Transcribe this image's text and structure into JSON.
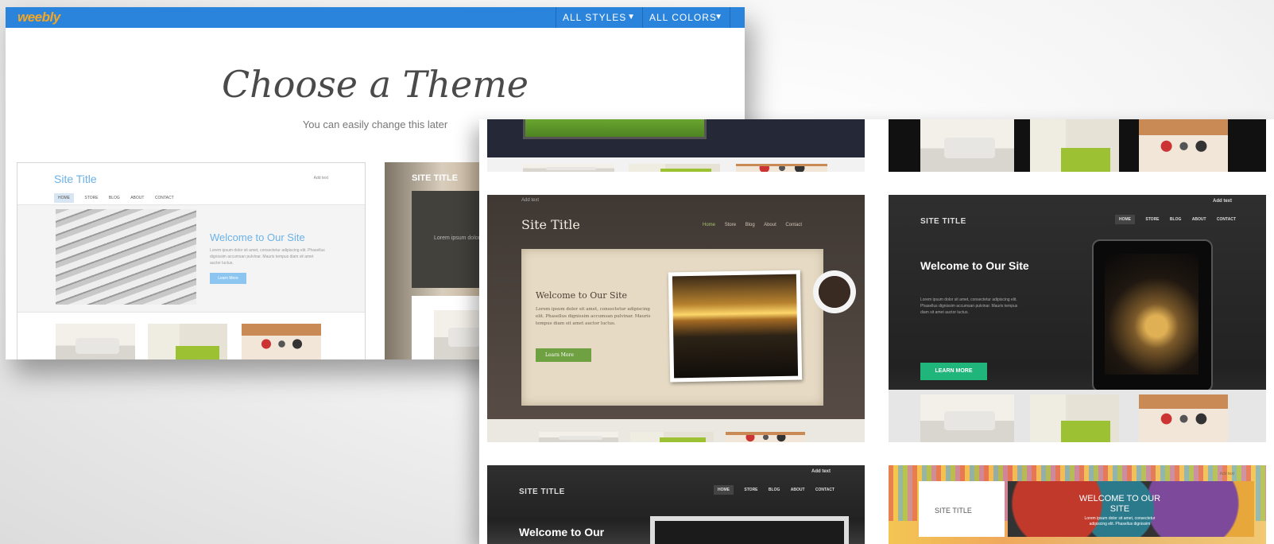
{
  "app": {
    "logo": "weebly",
    "brand_color": "#2b84db",
    "logo_color": "#f5a623"
  },
  "topbar": {
    "styles_label": "ALL STYLES",
    "colors_label": "ALL COLORS"
  },
  "heading": {
    "title": "Choose a Theme",
    "subtitle": "You can easily change this later"
  },
  "theme_light": {
    "site_title": "Site Title",
    "add_text": "Add text",
    "nav": [
      "HOME",
      "STORE",
      "BLOG",
      "ABOUT",
      "CONTACT"
    ],
    "welcome": "Welcome to Our Site",
    "lorem": "Lorem ipsum dolor sit amet, consectetur adipiscing elit. Phasellus dignissim accumsan pulvinar. Mauris tempus diam sit amet auctor luctus.",
    "button": "Learn More"
  },
  "theme_beige": {
    "site_title": "SITE TITLE",
    "lorem": "Lorem ipsum dolor"
  },
  "theme_rustic": {
    "add_text": "Add text",
    "site_title": "Site Title",
    "nav": [
      "Home",
      "Store",
      "Blog",
      "About",
      "Contact"
    ],
    "welcome": "Welcome to Our Site",
    "lorem": "Lorem ipsum dolor sit amet, consectetur adipiscing elit. Phasellus dignissim accumsan pulvinar. Mauris tempus diam sit amet auctor luctus.",
    "button": "Learn More"
  },
  "theme_dark": {
    "add_text": "Add text",
    "site_title": "SITE TITLE",
    "nav": [
      "HOME",
      "STORE",
      "BLOG",
      "ABOUT",
      "CONTACT"
    ],
    "welcome": "Welcome to Our Site",
    "lorem": "Lorem ipsum dolor sit amet, consectetur adipiscing elit. Phasellus dignissim accumsan pulvinar. Mauris tempus diam sit amet auctor luctus.",
    "button": "LEARN MORE",
    "button_color": "#1fb57b"
  },
  "theme_dark2": {
    "add_text": "Add text",
    "site_title": "SITE TITLE",
    "nav": [
      "HOME",
      "STORE",
      "BLOG",
      "ABOUT",
      "CONTACT"
    ],
    "welcome": "Welcome to Our"
  },
  "theme_colorful": {
    "add_text": "Add text",
    "site_title": "SITE TITLE",
    "welcome": "WELCOME TO OUR SITE",
    "lorem": "Lorem ipsum dolor sit amet, consectetur adipiscing elit. Phasellus dignissim"
  }
}
